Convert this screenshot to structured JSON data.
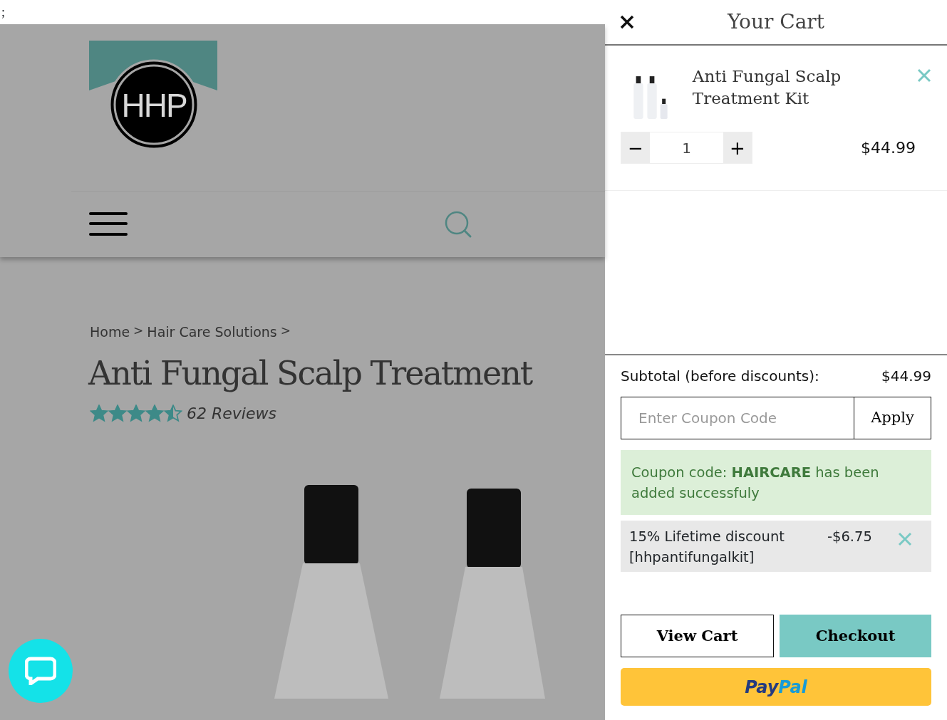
{
  "top_strip_text": ";",
  "site": {
    "logo_text": "HHP",
    "breadcrumb": [
      {
        "kind": "link",
        "text": "Home"
      },
      {
        "kind": "sep",
        "text": ">"
      },
      {
        "kind": "link",
        "text": "Hair Care Solutions"
      },
      {
        "kind": "sep",
        "text": ">"
      }
    ],
    "product_title": "Anti Fungal Scalp Treatment",
    "stars": 4.5,
    "reviews": "62 Reviews"
  },
  "cart": {
    "title": "Your Cart",
    "items": [
      {
        "name": "Anti Fungal Scalp Treatment Kit",
        "quantity": "1",
        "minus": "−",
        "plus": "+",
        "price": "$44.99"
      }
    ],
    "subtotal_label": "Subtotal (before discounts):",
    "subtotal": "$44.99",
    "coupon": {
      "placeholder": "Enter Coupon Code",
      "apply": "Apply"
    },
    "message": "Coupon code: **HAIRCARE** has been added successfuly",
    "discounts": [
      {
        "label": "15% Lifetime discount [hhpantifungalkit]",
        "amount": "-$6.75"
      }
    ],
    "view_cart": "View Cart",
    "checkout": "Checkout",
    "paypal": {
      "first": "Pay",
      "second": "Pal"
    }
  }
}
